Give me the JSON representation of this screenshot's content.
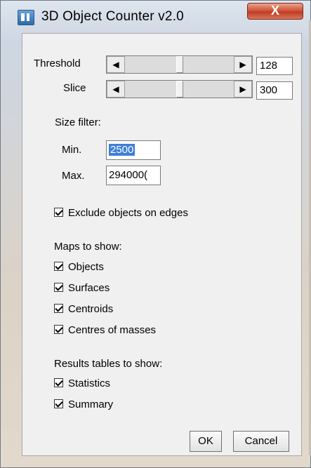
{
  "window": {
    "title": "3D Object Counter v2.0",
    "close_symbol": "X"
  },
  "threshold": {
    "label": "Threshold",
    "value": "128",
    "slider_fraction": 0.5,
    "left_arrow": "◀",
    "right_arrow": "▶"
  },
  "slice": {
    "label": "Slice",
    "value": "300",
    "slider_fraction": 0.5,
    "left_arrow": "◀",
    "right_arrow": "▶"
  },
  "size_filter": {
    "heading": "Size filter:",
    "min_label": "Min.",
    "min_value": "2500",
    "max_label": "Max.",
    "max_value": "294000("
  },
  "exclude_edges": {
    "label": "Exclude objects on edges",
    "checked": true
  },
  "maps": {
    "heading": "Maps to show:",
    "items": [
      {
        "label": "Objects",
        "checked": true
      },
      {
        "label": "Surfaces",
        "checked": true
      },
      {
        "label": "Centroids",
        "checked": true
      },
      {
        "label": "Centres of masses",
        "checked": true
      }
    ]
  },
  "results": {
    "heading": "Results tables to show:",
    "items": [
      {
        "label": "Statistics",
        "checked": true
      },
      {
        "label": "Summary",
        "checked": true
      }
    ]
  },
  "buttons": {
    "ok": "OK",
    "cancel": "Cancel"
  }
}
